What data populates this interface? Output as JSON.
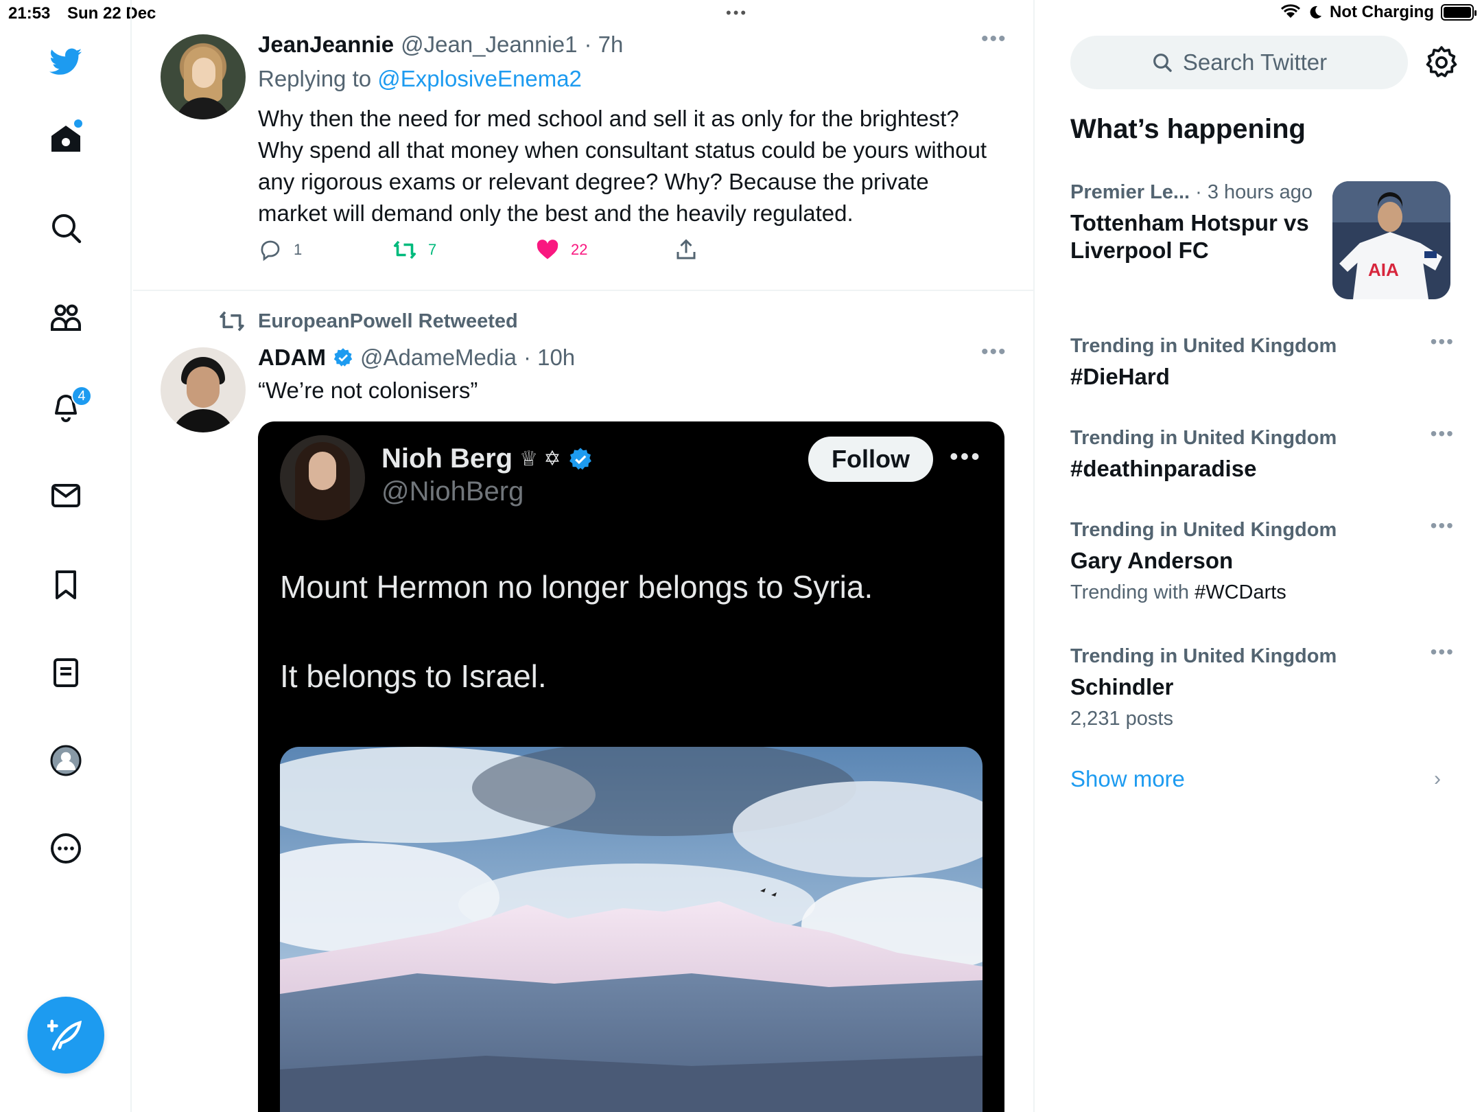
{
  "status_bar": {
    "time": "21:53",
    "date": "Sun 22 Dec",
    "charging": "Not Charging"
  },
  "nav": {
    "notifications_badge": "4"
  },
  "tweet1": {
    "name": "JeanJeannie",
    "handle": "@Jean_Jeannie1",
    "time": "· 7h",
    "replying_prefix": "Replying to ",
    "replying_to": "@ExplosiveEnema2",
    "text": "Why then the need for med school and sell it as only for the brightest? Why spend all that money when consultant status  could be yours without any rigorous exams or relevant degree? Why? Because the private market will demand only the best and the heavily regulated.",
    "replies": "1",
    "retweets": "7",
    "likes": "22"
  },
  "tweet2": {
    "retweeted_by": "EuropeanPowell Retweeted",
    "name": "ADAM",
    "handle": "@AdameMedia",
    "time": "· 10h",
    "text": "“We’re not colonisers”",
    "embed": {
      "name": "Nioh Berg",
      "symbols": "♕ ✡",
      "handle": "@NiohBerg",
      "follow_label": "Follow",
      "line1": "Mount Hermon no longer belongs to Syria.",
      "line2": "It belongs to Israel."
    }
  },
  "right": {
    "search_placeholder": "Search Twitter",
    "section_title": "What’s happening",
    "news": {
      "category": "Premier Le...",
      "time": " · 3 hours ago",
      "title": "Tottenham Hotspur vs Liverpool FC"
    },
    "trends": [
      {
        "category": "Trending in United Kingdom",
        "title": "#DieHard",
        "sub_prefix": "",
        "sub_tag": ""
      },
      {
        "category": "Trending in United Kingdom",
        "title": "#deathinparadise",
        "sub_prefix": "",
        "sub_tag": ""
      },
      {
        "category": "Trending in United Kingdom",
        "title": "Gary Anderson",
        "sub_prefix": "Trending with ",
        "sub_tag": "#WCDarts"
      },
      {
        "category": "Trending in United Kingdom",
        "title": "Schindler",
        "sub_prefix": "2,231 posts",
        "sub_tag": ""
      }
    ],
    "show_more": "Show more"
  },
  "colors": {
    "accent": "#1d9bf0",
    "like": "#f91880",
    "retweet": "#00ba7c",
    "text_secondary": "#536471"
  }
}
